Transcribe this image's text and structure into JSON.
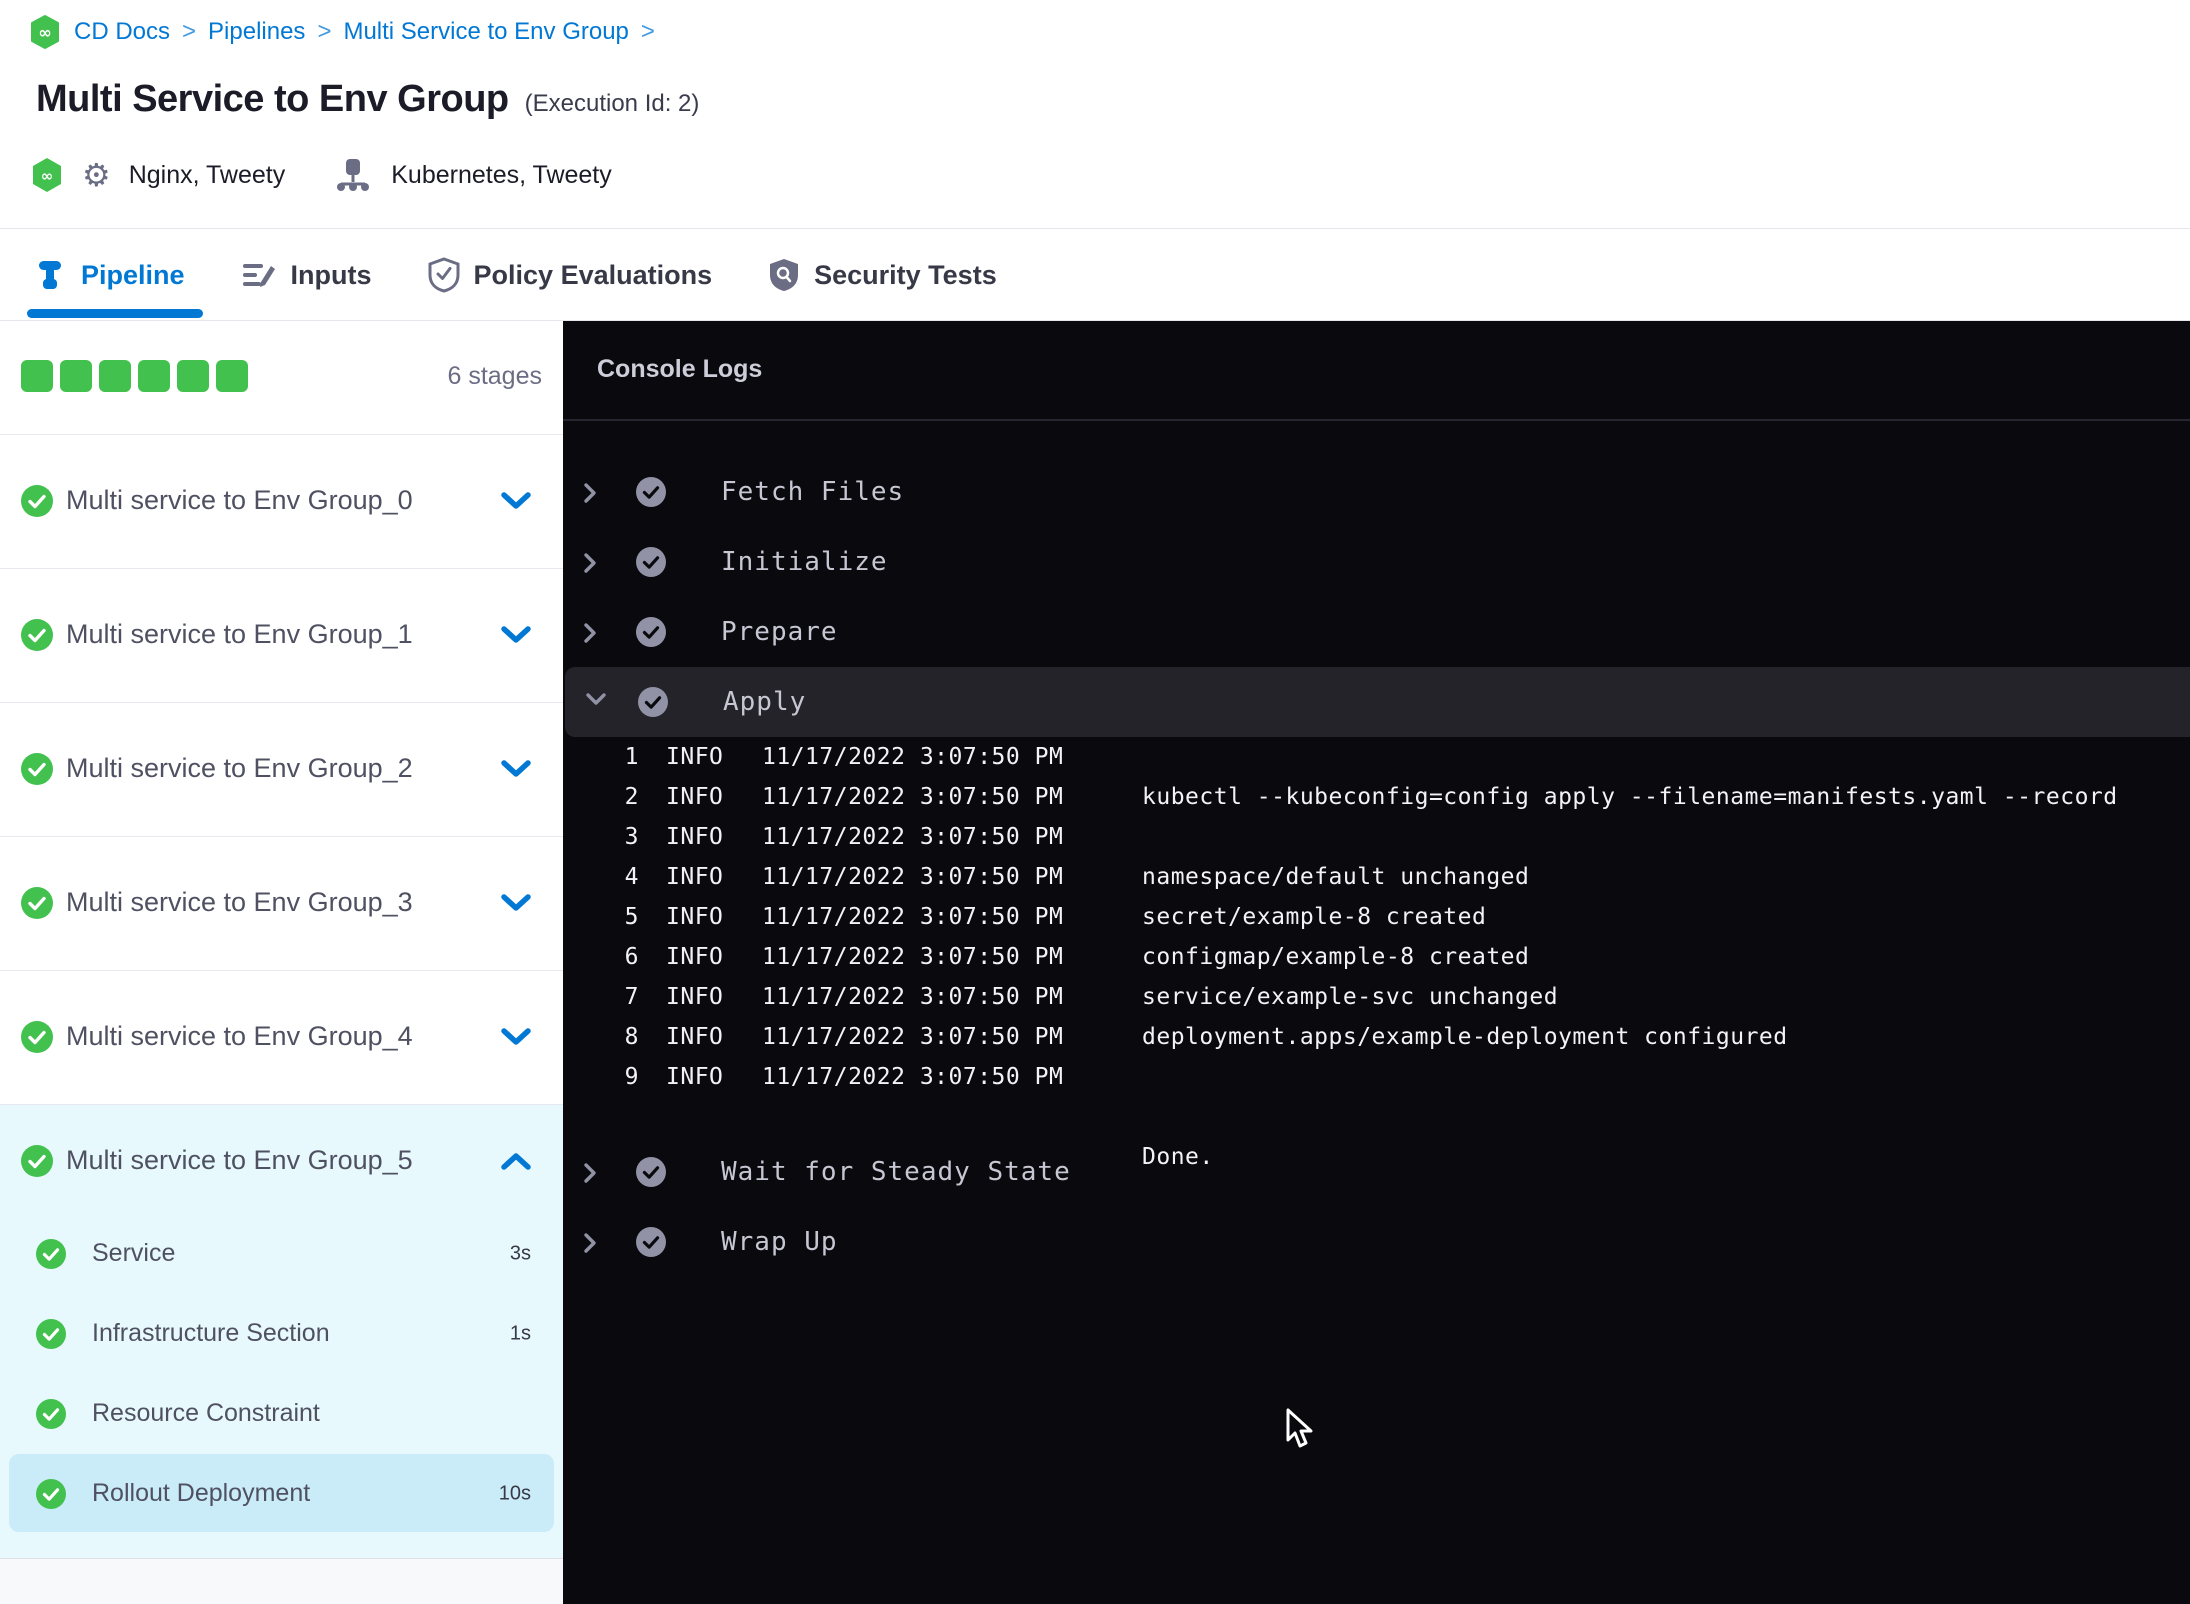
{
  "breadcrumb": {
    "items": [
      "CD Docs",
      "Pipelines",
      "Multi Service to Env Group"
    ],
    "separator": ">"
  },
  "header": {
    "title": "Multi Service to Env Group",
    "execution_id": "(Execution Id: 2)",
    "services_label": "Nginx, Tweety",
    "infrastructure_label": "Kubernetes, Tweety"
  },
  "tabs": [
    {
      "label": "Pipeline",
      "icon": "pipeline-icon",
      "active": true
    },
    {
      "label": "Inputs",
      "icon": "inputs-icon",
      "active": false
    },
    {
      "label": "Policy Evaluations",
      "icon": "policy-shield-icon",
      "active": false
    },
    {
      "label": "Security Tests",
      "icon": "security-shield-icon",
      "active": false
    }
  ],
  "stage_panel": {
    "squares_count": 6,
    "count_label": "6 stages",
    "collapsed_stages": [
      {
        "name": "Multi service to Env Group_0",
        "status": "success"
      },
      {
        "name": "Multi service to Env Group_1",
        "status": "success"
      },
      {
        "name": "Multi service to Env Group_2",
        "status": "success"
      },
      {
        "name": "Multi service to Env Group_3",
        "status": "success"
      },
      {
        "name": "Multi service to Env Group_4",
        "status": "success"
      }
    ],
    "expanded_stage": {
      "name": "Multi service to Env Group_5",
      "status": "success",
      "steps": [
        {
          "name": "Service",
          "duration": "3s",
          "selected": false
        },
        {
          "name": "Infrastructure Section",
          "duration": "1s",
          "selected": false
        },
        {
          "name": "Resource Constraint",
          "duration": "",
          "selected": false
        },
        {
          "name": "Rollout Deployment",
          "duration": "10s",
          "selected": true
        }
      ]
    }
  },
  "console": {
    "title": "Console Logs",
    "steps": [
      {
        "name": "Fetch Files",
        "expanded": false
      },
      {
        "name": "Initialize",
        "expanded": false
      },
      {
        "name": "Prepare",
        "expanded": false
      },
      {
        "name": "Apply",
        "expanded": true,
        "logs": [
          {
            "num": "1",
            "level": "INFO",
            "time": "11/17/2022 3:07:50 PM",
            "msg": ""
          },
          {
            "num": "2",
            "level": "INFO",
            "time": "11/17/2022 3:07:50 PM",
            "msg": "kubectl --kubeconfig=config apply --filename=manifests.yaml --record"
          },
          {
            "num": "3",
            "level": "INFO",
            "time": "11/17/2022 3:07:50 PM",
            "msg": ""
          },
          {
            "num": "4",
            "level": "INFO",
            "time": "11/17/2022 3:07:50 PM",
            "msg": "namespace/default unchanged"
          },
          {
            "num": "5",
            "level": "INFO",
            "time": "11/17/2022 3:07:50 PM",
            "msg": "secret/example-8 created"
          },
          {
            "num": "6",
            "level": "INFO",
            "time": "11/17/2022 3:07:50 PM",
            "msg": "configmap/example-8 created"
          },
          {
            "num": "7",
            "level": "INFO",
            "time": "11/17/2022 3:07:50 PM",
            "msg": "service/example-svc unchanged"
          },
          {
            "num": "8",
            "level": "INFO",
            "time": "11/17/2022 3:07:50 PM",
            "msg": "deployment.apps/example-deployment configured"
          },
          {
            "num": "9",
            "level": "INFO",
            "time": "11/17/2022 3:07:50 PM",
            "msg": ""
          }
        ],
        "trailing_line": "Done."
      },
      {
        "name": "Wait for Steady State",
        "expanded": false
      },
      {
        "name": "Wrap Up",
        "expanded": false
      }
    ]
  },
  "colors": {
    "accent_blue": "#0278d5",
    "success_green": "#42c14e",
    "console_bg": "#0a0a0e",
    "console_row_highlight": "#232329",
    "console_text": "#f2f2f7",
    "step_text": "#c6c7d2",
    "icon_gray": "#9192a5",
    "expanded_bg": "#e7f9fd",
    "selected_step_bg": "#c9ecf8"
  },
  "icons": [
    "harness-logo-icon",
    "gear-icon",
    "infrastructure-icon",
    "pipeline-icon",
    "inputs-icon",
    "policy-shield-icon",
    "security-shield-icon",
    "check-circle-icon",
    "chevron-down-icon",
    "chevron-up-icon",
    "chevron-right-icon",
    "mouse-cursor"
  ]
}
